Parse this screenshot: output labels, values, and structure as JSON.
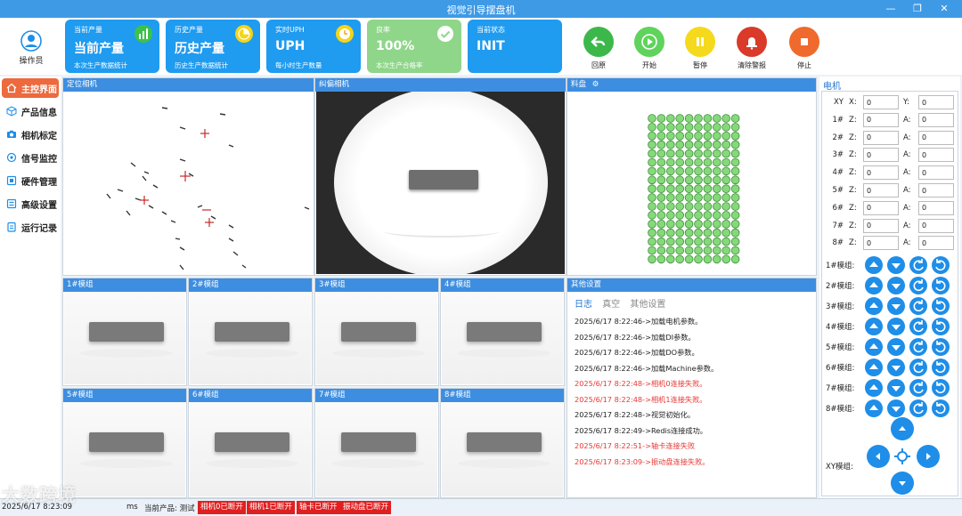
{
  "window": {
    "title": "视觉引导摆盘机",
    "min": "—",
    "max": "❐",
    "close": "✕"
  },
  "operator": {
    "label": "操作员"
  },
  "cards": [
    {
      "label": "当前产量",
      "value": "当前产量",
      "sub": "本次生产数据统计",
      "icon": "bar-chart-icon",
      "color": "#1f9bf0"
    },
    {
      "label": "历史产量",
      "value": "历史产量",
      "sub": "历史生产数据统计",
      "icon": "pie-chart-icon",
      "color": "#1f9bf0"
    },
    {
      "label": "实时UPH",
      "value": "UPH",
      "sub": "每小时生产数量",
      "icon": "clock-icon",
      "color": "#1f9bf0"
    },
    {
      "label": "良率",
      "value": "100%",
      "sub": "本次生产合格率",
      "icon": "check-circle-icon",
      "color": "#8fd68a"
    },
    {
      "label": "当前状态",
      "value": "INIT",
      "sub": "",
      "icon": "",
      "color": "#1f9bf0"
    }
  ],
  "controls": [
    {
      "label": "回原",
      "icon": "home-return-icon",
      "color": "#3cb84a"
    },
    {
      "label": "开始",
      "icon": "play-icon",
      "color": "#5fd35c"
    },
    {
      "label": "暂停",
      "icon": "pause-icon",
      "color": "#f5d91c"
    },
    {
      "label": "清除警报",
      "icon": "alarm-bell-icon",
      "color": "#d93a2a"
    },
    {
      "label": "停止",
      "icon": "stop-icon",
      "color": "#ef6a2c"
    }
  ],
  "sidebar": {
    "items": [
      {
        "label": "主控界面",
        "icon": "home-icon",
        "active": true
      },
      {
        "label": "产品信息",
        "icon": "cube-icon",
        "active": false
      },
      {
        "label": "相机标定",
        "icon": "camera-icon",
        "active": false
      },
      {
        "label": "信号监控",
        "icon": "signal-icon",
        "active": false
      },
      {
        "label": "硬件管理",
        "icon": "hardware-icon",
        "active": false
      },
      {
        "label": "高级设置",
        "icon": "settings-icon",
        "active": false
      },
      {
        "label": "运行记录",
        "icon": "record-icon",
        "active": false
      }
    ]
  },
  "cameras": {
    "positioning": "定位相机",
    "correction": "纠偏相机",
    "tray": "料盘"
  },
  "modules": [
    "1#模组",
    "2#模组",
    "3#模组",
    "4#模组",
    "5#模组",
    "6#模组",
    "7#模组",
    "8#模组"
  ],
  "settings": {
    "header": "其他设置",
    "tabs": [
      "日志",
      "真空",
      "其他设置"
    ],
    "logs": [
      {
        "text": "2025/6/17 8:22:46->加载电机参数。",
        "error": false
      },
      {
        "text": "2025/6/17 8:22:46->加载DI参数。",
        "error": false
      },
      {
        "text": "2025/6/17 8:22:46->加载DO参数。",
        "error": false
      },
      {
        "text": "2025/6/17 8:22:46->加载Machine参数。",
        "error": false
      },
      {
        "text": "2025/6/17 8:22:48->相机0连接失败。",
        "error": true
      },
      {
        "text": "2025/6/17 8:22:48->相机1连接失败。",
        "error": true
      },
      {
        "text": "2025/6/17 8:22:48->视觉初始化。",
        "error": false
      },
      {
        "text": "2025/6/17 8:22:49->Redis连接成功。",
        "error": false
      },
      {
        "text": "2025/6/17 8:22:51->轴卡连接失败",
        "error": true
      },
      {
        "text": "2025/6/17 8:23:09->振动盘连接失败。",
        "error": true
      }
    ]
  },
  "motor": {
    "title": "电机",
    "rows": [
      {
        "label": "XY",
        "a1": "X:",
        "v1": "0",
        "a2": "Y:",
        "v2": "0"
      },
      {
        "label": "1#",
        "a1": "Z:",
        "v1": "0",
        "a2": "A:",
        "v2": "0"
      },
      {
        "label": "2#",
        "a1": "Z:",
        "v1": "0",
        "a2": "A:",
        "v2": "0"
      },
      {
        "label": "3#",
        "a1": "Z:",
        "v1": "0",
        "a2": "A:",
        "v2": "0"
      },
      {
        "label": "4#",
        "a1": "Z:",
        "v1": "0",
        "a2": "A:",
        "v2": "0"
      },
      {
        "label": "5#",
        "a1": "Z:",
        "v1": "0",
        "a2": "A:",
        "v2": "0"
      },
      {
        "label": "6#",
        "a1": "Z:",
        "v1": "0",
        "a2": "A:",
        "v2": "0"
      },
      {
        "label": "7#",
        "a1": "Z:",
        "v1": "0",
        "a2": "A:",
        "v2": "0"
      },
      {
        "label": "8#",
        "a1": "Z:",
        "v1": "0",
        "a2": "A:",
        "v2": "0"
      }
    ],
    "modules": [
      "1#模组:",
      "2#模组:",
      "3#模组:",
      "4#模组:",
      "5#模组:",
      "6#模组:",
      "7#模组:",
      "8#模组:"
    ],
    "xy_label": "XY模组:"
  },
  "status": {
    "time": "2025/6/17 8:23:09",
    "cycle": "ms",
    "product": "当前产品: 测试",
    "alerts": [
      "相机0已断开",
      "相机1已断开",
      "轴卡已断开",
      "振动盘已断开"
    ]
  },
  "watermark": "大数跨境"
}
